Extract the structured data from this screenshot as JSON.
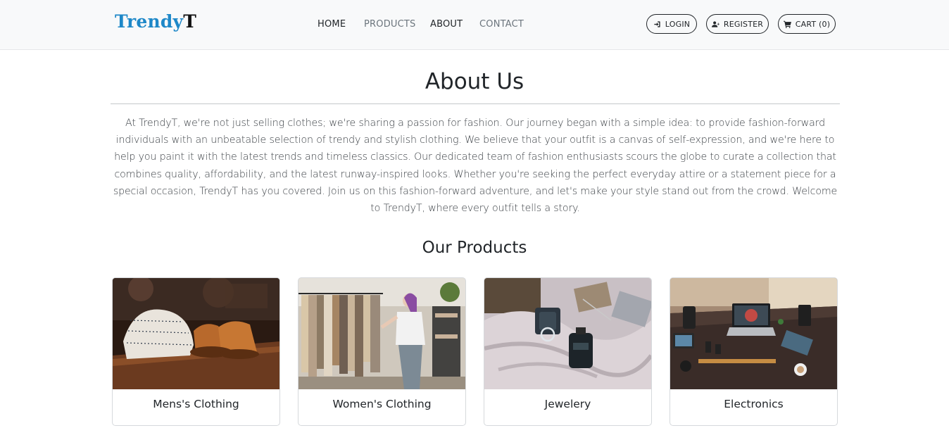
{
  "brand": {
    "part1": "Trendy",
    "part2": "T"
  },
  "nav": {
    "home": "HOME",
    "products": "PRODUCTS",
    "about": "ABOUT",
    "contact": "CONTACT"
  },
  "actions": {
    "login": "LOGIN",
    "register": "REGISTER",
    "cart": "CART (0)"
  },
  "about": {
    "title": "About Us",
    "text": "At TrendyT, we're not just selling clothes; we're sharing a passion for fashion. Our journey began with a simple idea: to provide fashion-forward individuals with an unbeatable selection of trendy and stylish clothing. We believe that your outfit is a canvas of self-expression, and we're here to help you paint it with the latest trends and timeless classics. Our dedicated team of fashion enthusiasts scours the globe to curate a collection that combines quality, affordability, and the latest runway-inspired looks. Whether you're seeking the perfect everyday attire or a statement piece for a special occasion, TrendyT has you covered. Join us on this fashion-forward adventure, and let's make your style stand out from the crowd. Welcome to TrendyT, where every outfit tells a story."
  },
  "products": {
    "title": "Our Products",
    "items": [
      {
        "label": "Mens's Clothing",
        "icon": "mens-clothing-photo"
      },
      {
        "label": "Women's Clothing",
        "icon": "womens-clothing-photo"
      },
      {
        "label": "Jewelery",
        "icon": "jewelery-photo"
      },
      {
        "label": "Electronics",
        "icon": "electronics-photo"
      }
    ]
  },
  "colors": {
    "brand_primary": "#1e88c8",
    "brand_secondary": "#111111",
    "navbar_bg": "#f8f9fa",
    "text": "#212529",
    "muted": "#6c757d"
  }
}
